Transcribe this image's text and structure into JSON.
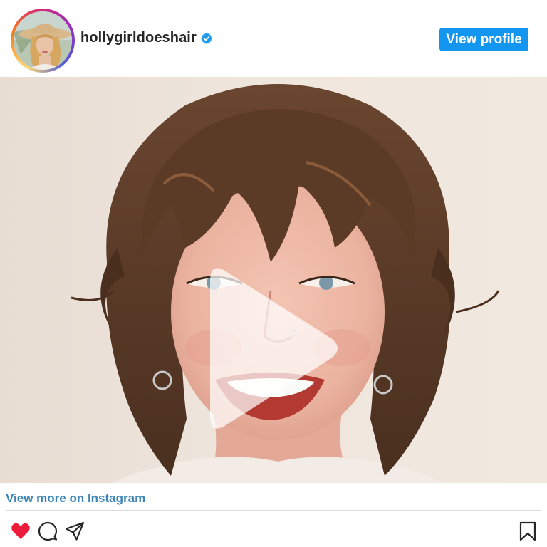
{
  "header": {
    "username": "hollygirldoeshair",
    "verified": true,
    "view_profile_label": "View profile",
    "accent_color": "#1296f0",
    "avatar_icon": "avatar-photo"
  },
  "media": {
    "type": "video",
    "play_icon": "play-icon"
  },
  "footer": {
    "view_more_label": "View more on Instagram",
    "link_color": "#3f86b8",
    "actions": [
      "heart-icon",
      "comment-icon",
      "share-icon"
    ],
    "save_icon": "bookmark-icon",
    "liked_color": "#ed1c3a"
  }
}
